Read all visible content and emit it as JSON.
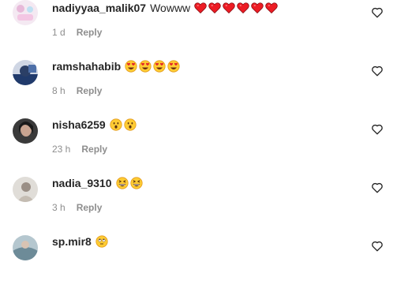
{
  "comments": [
    {
      "username": "nadiyyaa_malik07",
      "text": "Wowww",
      "emojis": [
        "red-heart",
        "red-heart",
        "red-heart",
        "red-heart",
        "red-heart",
        "red-heart"
      ],
      "time": "1 d",
      "reply": "Reply"
    },
    {
      "username": "ramshahabib",
      "text": "",
      "emojis": [
        "heart-eyes",
        "heart-eyes",
        "heart-eyes",
        "heart-eyes"
      ],
      "time": "8 h",
      "reply": "Reply"
    },
    {
      "username": "nisha6259",
      "text": "",
      "emojis": [
        "hushed-face",
        "hushed-face"
      ],
      "time": "23 h",
      "reply": "Reply"
    },
    {
      "username": "nadia_9310",
      "text": "",
      "emojis": [
        "grinning-squint",
        "grinning-squint"
      ],
      "time": "3 h",
      "reply": "Reply"
    },
    {
      "username": "sp.mir8",
      "text": "",
      "emojis": [
        "face-rolling-eyes"
      ],
      "time": "",
      "reply": ""
    }
  ],
  "colors": {
    "text": "#262626",
    "meta": "#8e8e8e",
    "heart": "#ed1c24"
  }
}
